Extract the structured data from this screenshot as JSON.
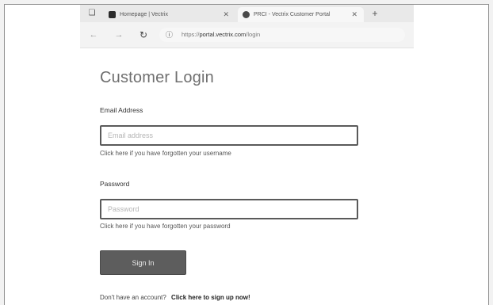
{
  "browser": {
    "tabs": [
      {
        "title": "Homepage | Vectrix",
        "active": false
      },
      {
        "title": "PRCI - Vectrix Customer Portal",
        "active": true
      }
    ],
    "address": {
      "url_prefix": "https://",
      "url_host": "portal.vectrix.com",
      "url_path": "/login"
    }
  },
  "page": {
    "title": "Customer Login",
    "email": {
      "label": "Email Address",
      "placeholder": "Email address",
      "value": "",
      "help_link": "Click here if you have forgotten your username"
    },
    "password": {
      "label": "Password",
      "placeholder": "Password",
      "value": "",
      "help_link": "Click here if you have forgotten your password"
    },
    "signin_label": "Sign In",
    "signup": {
      "prompt": "Don't have an account?",
      "link": "Click here to sign up now!"
    }
  },
  "colors": {
    "button_bg": "#5d5d5d",
    "title_text": "#6f6f6f",
    "input_border": "#5a5a5a"
  }
}
